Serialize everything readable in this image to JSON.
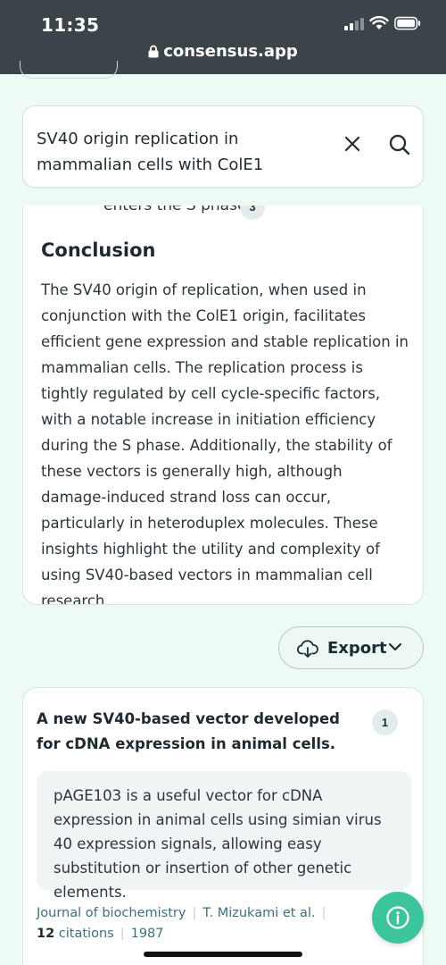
{
  "status_bar": {
    "time": "11:35",
    "url": "consensus.app"
  },
  "search": {
    "query": "SV40 origin replication in mammalian cells with ColE1"
  },
  "conclusion": {
    "cut_text": "enters the S phase",
    "cut_badge": "3",
    "title": "Conclusion",
    "body": "The SV40 origin of replication, when used in conjunction with the ColE1 origin, facilitates efficient gene expression and stable replication in mammalian cells. The replication process is tightly regulated by cell cycle-specific factors, with a notable increase in initiation efficiency during the S phase. Additionally, the stability of these vectors is generally high, although damage-induced strand loss can occur, particularly in heteroduplex molecules. These insights highlight the utility and complexity of using SV40-based vectors in mammalian cell research."
  },
  "export": {
    "label": "Export"
  },
  "result": {
    "title": "A new SV40-based vector developed for cDNA expression in animal cells.",
    "badge": "1",
    "summary": "pAGE103 is a useful vector for cDNA expression in animal cells using simian virus 40 expression signals, allowing easy substitution or insertion of other genetic elements.",
    "journal": "Journal of biochemistry",
    "authors": "T. Mizukami et al.",
    "citations_count": "12",
    "citations_label": "citations",
    "year": "1987"
  },
  "colors": {
    "accent": "#3cc59d",
    "background": "#eefaf4",
    "statusbar": "#3b4449",
    "link": "#3e6f7c"
  },
  "icons": [
    "lock-icon",
    "close-icon",
    "search-icon",
    "export-icon",
    "chevron-down-icon",
    "info-icon"
  ]
}
